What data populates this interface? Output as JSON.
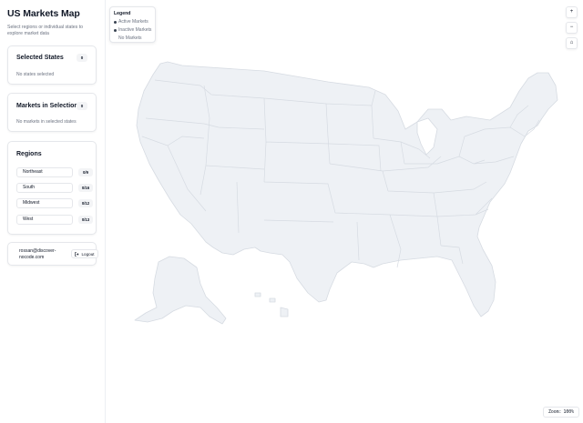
{
  "sidebar": {
    "title": "US Markets Map",
    "subtitle": "Select regions or individual states to explore market data"
  },
  "selected_states": {
    "title": "Selected States",
    "count": "0",
    "empty_text": "No states selected"
  },
  "markets": {
    "title": "Markets in Selection",
    "count": "0",
    "empty_text": "No markets in selected states"
  },
  "regions": {
    "title": "Regions",
    "items": [
      {
        "label": "Northeast",
        "count": "0/9"
      },
      {
        "label": "South",
        "count": "0/16"
      },
      {
        "label": "Midwest",
        "count": "0/12"
      },
      {
        "label": "West",
        "count": "0/13"
      }
    ]
  },
  "user": {
    "email": "rossan@discover-nocode.com",
    "logout_label": "Logout"
  },
  "legend": {
    "title": "Legend",
    "items": [
      {
        "label": "Active Markets",
        "icon": "filled-dot"
      },
      {
        "label": "Inactive Markets",
        "icon": "filled-dot"
      },
      {
        "label": "No Markets",
        "icon": "none"
      }
    ]
  },
  "map_controls": {
    "zoom_in": "+",
    "zoom_out": "−",
    "reset": "⌂"
  },
  "zoom": {
    "label": "Zoom:",
    "value": "100%"
  },
  "colors": {
    "state_fill": "#eef1f5",
    "state_border": "#d6dbe2",
    "text_primary": "#111827",
    "text_muted": "#6b7280",
    "badge_bg": "#f3f4f6"
  }
}
